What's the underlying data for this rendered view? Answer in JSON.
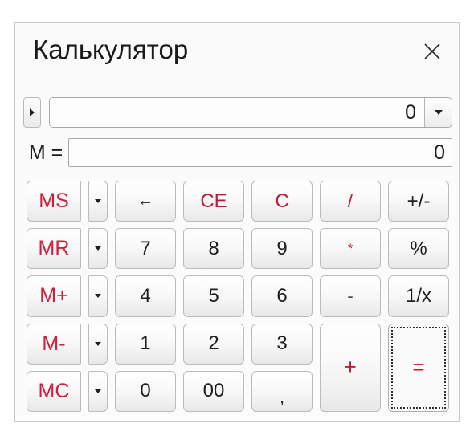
{
  "window": {
    "title": "Калькулятор",
    "close_label": "×"
  },
  "display": {
    "expand_icon": "triangle-right-icon",
    "value": "0",
    "dropdown_icon": "chevron-down-icon"
  },
  "memory": {
    "label": "M =",
    "value": "0"
  },
  "keypad": {
    "dropdown_icon": "chevron-down-icon",
    "rows": [
      {
        "memory": "MS",
        "keys": [
          "←",
          "CE",
          "C",
          "/",
          "+/-"
        ]
      },
      {
        "memory": "MR",
        "keys": [
          "7",
          "8",
          "9",
          "*",
          "%"
        ]
      },
      {
        "memory": "M+",
        "keys": [
          "4",
          "5",
          "6",
          "-",
          "1/x"
        ]
      },
      {
        "memory": "M-",
        "keys": [
          "1",
          "2",
          "3",
          "+",
          "="
        ]
      },
      {
        "memory": "MC",
        "keys": [
          "0",
          "00",
          ",",
          "",
          ""
        ]
      }
    ],
    "labels": {
      "ms": "MS",
      "mr": "MR",
      "mplus": "M+",
      "mminus": "M-",
      "mc": "MC",
      "backspace": "←",
      "ce": "CE",
      "c": "C",
      "divide": "/",
      "plusminus": "+/-",
      "seven": "7",
      "eight": "8",
      "nine": "9",
      "multiply": "*",
      "percent": "%",
      "four": "4",
      "five": "5",
      "six": "6",
      "subtract": "-",
      "reciprocal": "1/x",
      "one": "1",
      "two": "2",
      "three": "3",
      "add": "+",
      "equals": "=",
      "zero": "0",
      "doublezero": "00",
      "comma": ","
    }
  },
  "colors": {
    "accent_red": "#cf1f3f",
    "text_dark": "#1e1e1e",
    "window_bg": "#fbfbfb"
  }
}
